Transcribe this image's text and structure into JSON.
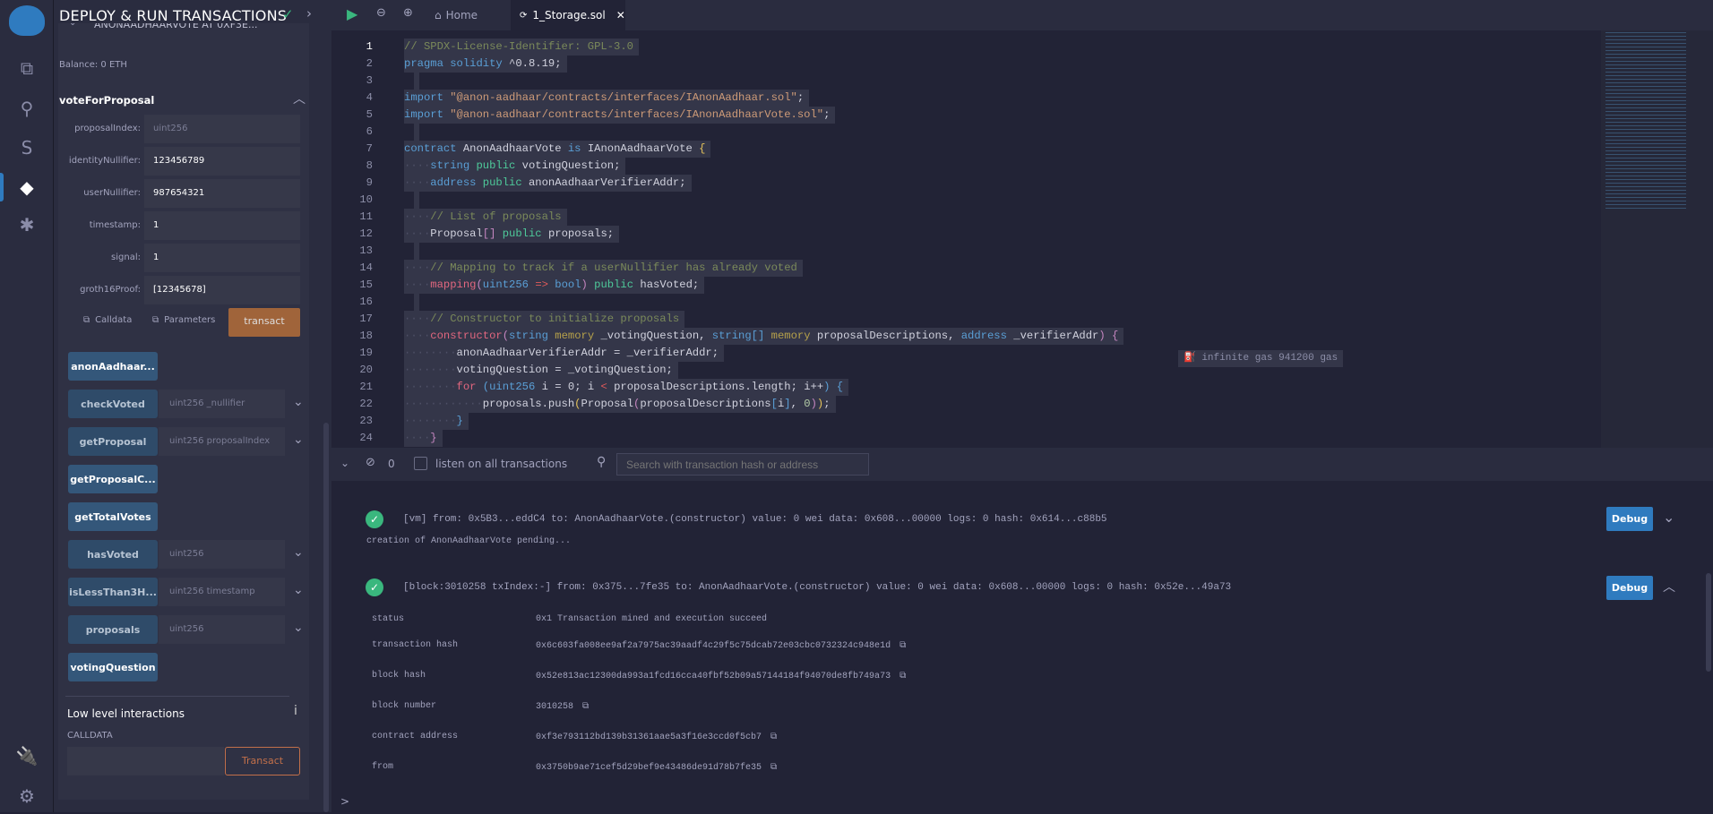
{
  "iconbar": {
    "items": [
      {
        "icon": "file-explorer-icon",
        "glyph": "⧉"
      },
      {
        "icon": "search-icon",
        "glyph": "⚲"
      },
      {
        "icon": "solidity-compiler-icon",
        "glyph": "S"
      },
      {
        "icon": "deploy-run-icon",
        "glyph": "◆"
      },
      {
        "icon": "debugger-icon",
        "glyph": "✱"
      }
    ],
    "bottom": [
      {
        "icon": "plugin-manager-icon",
        "glyph": "🔌"
      },
      {
        "icon": "settings-gear-icon",
        "glyph": "⚙"
      }
    ]
  },
  "side": {
    "title": "DEPLOY & RUN TRANSACTIONS",
    "contract": "ANONAADHAARVOTE AT 0XF3E...",
    "balance": "Balance: 0 ETH",
    "function_title": "voteForProposal",
    "params": [
      {
        "label": "proposalIndex:",
        "value": "",
        "placeholder": "uint256"
      },
      {
        "label": "identityNullifier:",
        "value": "123456789"
      },
      {
        "label": "userNullifier:",
        "value": "987654321"
      },
      {
        "label": "timestamp:",
        "value": "1"
      },
      {
        "label": "signal:",
        "value": "1"
      },
      {
        "label": "groth16Proof:",
        "value": "[12345678]"
      }
    ],
    "calldata_label": "Calldata",
    "parameters_label": "Parameters",
    "transact_label": "transact",
    "functions": [
      {
        "name": "anonAadhaar...",
        "constant": true
      },
      {
        "name": "checkVoted",
        "input": "uint256 _nullifier",
        "constant": false
      },
      {
        "name": "getProposal",
        "input": "uint256 proposalIndex",
        "constant": false
      },
      {
        "name": "getProposalC...",
        "constant": true
      },
      {
        "name": "getTotalVotes",
        "constant": true
      },
      {
        "name": "hasVoted",
        "input": "uint256",
        "constant": false
      },
      {
        "name": "isLessThan3H...",
        "input": "uint256 timestamp",
        "constant": false
      },
      {
        "name": "proposals",
        "input": "uint256",
        "constant": false
      },
      {
        "name": "votingQuestion",
        "constant": true
      }
    ],
    "low_level_title": "Low level interactions",
    "calldata_caption": "CALLDATA",
    "low_transact": "Transact"
  },
  "tabs": {
    "home": "Home",
    "active": "1_Storage.sol"
  },
  "code": [
    [
      [
        "// SPDX-License-Identifier: GPL-3.0",
        "cm"
      ]
    ],
    [
      [
        "pragma solidity",
        "kw"
      ],
      [
        " ^0.8.19;",
        "pl"
      ]
    ],
    [],
    [
      [
        "import ",
        "kw"
      ],
      [
        "\"@anon-aadhaar/contracts/interfaces/IAnonAadhaar.sol\"",
        "str"
      ],
      [
        ";",
        "pl"
      ]
    ],
    [
      [
        "import ",
        "kw"
      ],
      [
        "\"@anon-aadhaar/contracts/interfaces/IAnonAadhaarVote.sol\"",
        "str"
      ],
      [
        ";",
        "pl"
      ]
    ],
    [],
    [
      [
        "contract ",
        "kw"
      ],
      [
        "AnonAadhaarVote ",
        "pl"
      ],
      [
        "is ",
        "kw"
      ],
      [
        "IAnonAadhaarVote ",
        "pl"
      ],
      [
        "{",
        "br"
      ]
    ],
    [
      [
        "····",
        "dim"
      ],
      [
        "string ",
        "kw"
      ],
      [
        "public ",
        "pub"
      ],
      [
        "votingQuestion;",
        "pl"
      ]
    ],
    [
      [
        "····",
        "dim"
      ],
      [
        "address ",
        "kw"
      ],
      [
        "public ",
        "pub"
      ],
      [
        "anonAadhaarVerifierAddr;",
        "pl"
      ]
    ],
    [],
    [
      [
        "····",
        "dim"
      ],
      [
        "// List of proposals",
        "cm"
      ]
    ],
    [
      [
        "····",
        "dim"
      ],
      [
        "Proposal",
        "pl"
      ],
      [
        "[]",
        "pur"
      ],
      [
        " public ",
        "pub"
      ],
      [
        "proposals;",
        "pl"
      ]
    ],
    [],
    [
      [
        "····",
        "dim"
      ],
      [
        "// Mapping to track if a userNullifier has already voted",
        "cm"
      ]
    ],
    [
      [
        "····",
        "dim"
      ],
      [
        "mapping",
        "fn"
      ],
      [
        "(",
        "pur"
      ],
      [
        "uint256 ",
        "kw"
      ],
      [
        "=>",
        "op"
      ],
      [
        " bool",
        "kw"
      ],
      [
        ")",
        "pur"
      ],
      [
        " public ",
        "pub"
      ],
      [
        "hasVoted;",
        "pl"
      ]
    ],
    [],
    [
      [
        "····",
        "dim"
      ],
      [
        "// Constructor to initialize proposals",
        "cm"
      ]
    ],
    [
      [
        "····",
        "dim"
      ],
      [
        "constructor",
        "fn"
      ],
      [
        "(",
        "pur"
      ],
      [
        "string ",
        "kw"
      ],
      [
        "memory ",
        "mem"
      ],
      [
        "_votingQuestion, ",
        "pl"
      ],
      [
        "string[] ",
        "kw"
      ],
      [
        "memory ",
        "mem"
      ],
      [
        "proposalDescriptions, ",
        "pl"
      ],
      [
        "address ",
        "kw"
      ],
      [
        "_verifierAddr",
        "pl"
      ],
      [
        ") {",
        "pur"
      ]
    ],
    [
      [
        "········",
        "dim"
      ],
      [
        "anonAadhaarVerifierAddr = _verifierAddr;",
        "pl"
      ]
    ],
    [
      [
        "········",
        "dim"
      ],
      [
        "votingQuestion = _votingQuestion;",
        "pl"
      ]
    ],
    [
      [
        "········",
        "dim"
      ],
      [
        "for ",
        "fn"
      ],
      [
        "(",
        "kw"
      ],
      [
        "uint256 ",
        "kw"
      ],
      [
        "i = 0; i ",
        "pl"
      ],
      [
        "<",
        "op"
      ],
      [
        " proposalDescriptions.length; i++",
        "pl"
      ],
      [
        ") {",
        "kw"
      ]
    ],
    [
      [
        "············",
        "dim"
      ],
      [
        "proposals.push",
        "pl"
      ],
      [
        "(",
        "br"
      ],
      [
        "Proposal",
        "pl"
      ],
      [
        "(",
        "pur"
      ],
      [
        "proposalDescriptions",
        "pl"
      ],
      [
        "[",
        "kw"
      ],
      [
        "i",
        "pl"
      ],
      [
        "]",
        "kw"
      ],
      [
        ", ",
        "pl"
      ],
      [
        "0",
        "num"
      ],
      [
        ")",
        "pur"
      ],
      [
        ")",
        "br"
      ],
      [
        ";",
        "pl"
      ]
    ],
    [
      [
        "········",
        "dim"
      ],
      [
        "}",
        "kw"
      ]
    ],
    [
      [
        "····",
        "dim"
      ],
      [
        "}",
        "pur"
      ]
    ]
  ],
  "gas_hint": "infinite gas 941200 gas",
  "terminal": {
    "count": "0",
    "listen_label": "listen on all transactions",
    "search_placeholder": "Search with transaction hash or address",
    "tx1": "[vm]  from: 0x5B3...eddC4 to: AnonAadhaarVote.(constructor) value: 0 wei data: 0x608...00000 logs: 0 hash: 0x614...c88b5",
    "pending": "creation of AnonAadhaarVote pending...",
    "tx2": "[block:3010258 txIndex:-]  from: 0x375...7fe35 to: AnonAadhaarVote.(constructor) value: 0 wei data: 0x608...00000 logs: 0 hash: 0x52e...49a73",
    "debug": "Debug",
    "details": [
      {
        "label": "status",
        "value": "0x1 Transaction mined and execution succeed"
      },
      {
        "label": "transaction hash",
        "value": "0x6c603fa008ee9af2a7975ac39aadf4c29f5c75dcab72e03cbc0732324c948e1d",
        "copy": true
      },
      {
        "label": "block hash",
        "value": "0x52e813ac12300da993a1fcd16cca40fbf52b09a57144184f94070de8fb749a73",
        "copy": true
      },
      {
        "label": "block number",
        "value": "3010258",
        "copy": true
      },
      {
        "label": "contract address",
        "value": "0xf3e793112bd139b31361aae5a3f16e3ccd0f5cb7",
        "copy": true
      },
      {
        "label": "from",
        "value": "0x3750b9ae71cef5d29bef9e43486de91d78b7fe35",
        "copy": true
      }
    ],
    "prompt": ">"
  },
  "colors": {
    "accent": "#2f7bbf",
    "transact": "#a0643a",
    "success": "#3ab77e"
  }
}
